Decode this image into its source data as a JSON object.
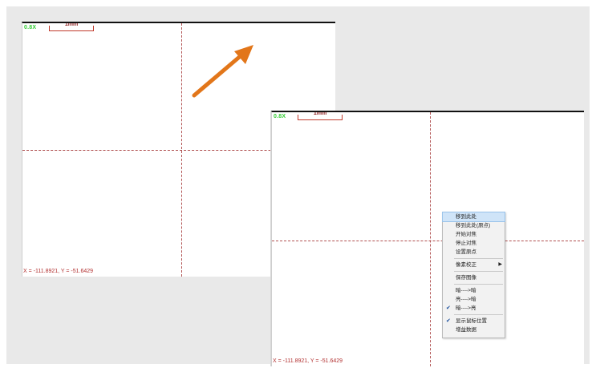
{
  "colors": {
    "zoom_label": "#33cc33",
    "crosshair": "#b05050",
    "arrow": "#e2761a",
    "menu_highlight": "#cfe4f8"
  },
  "view_left": {
    "zoom": "0.8X",
    "scale": "1mm",
    "coords": "X = -111.8921, Y = -51.6429"
  },
  "view_right": {
    "zoom": "0.8X",
    "scale": "1mm",
    "coords": "X = -111.8921, Y = -51.6429"
  },
  "arrow_icon": "arrow-up-right-icon",
  "context_menu": {
    "items": [
      {
        "label": "移到此处",
        "selected": true,
        "checked": false,
        "submenu": false
      },
      {
        "label": "移到此处(原点)",
        "selected": false,
        "checked": false,
        "submenu": false
      },
      {
        "label": "开始对焦",
        "selected": false,
        "checked": false,
        "submenu": false
      },
      {
        "label": "停止对焦",
        "selected": false,
        "checked": false,
        "submenu": false
      },
      {
        "label": "设置原点",
        "selected": false,
        "checked": false,
        "submenu": false
      },
      {
        "sep": true
      },
      {
        "label": "像素校正",
        "selected": false,
        "checked": false,
        "submenu": true
      },
      {
        "sep": true
      },
      {
        "label": "保存图像",
        "selected": false,
        "checked": false,
        "submenu": false
      },
      {
        "sep": true
      },
      {
        "label": "暗---->暗",
        "selected": false,
        "checked": false,
        "submenu": false
      },
      {
        "label": "亮---->暗",
        "selected": false,
        "checked": false,
        "submenu": false
      },
      {
        "label": "暗---->亮",
        "selected": false,
        "checked": true,
        "submenu": false
      },
      {
        "sep": true
      },
      {
        "label": "显示鼠标位置",
        "selected": false,
        "checked": true,
        "submenu": false
      },
      {
        "label": "增益数据",
        "selected": false,
        "checked": false,
        "submenu": false
      }
    ]
  }
}
